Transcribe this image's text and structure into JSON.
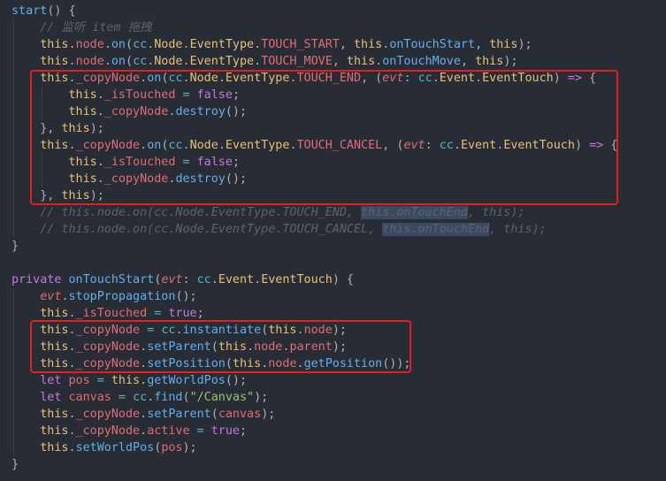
{
  "editor": {
    "colors": {
      "background": "#282c34",
      "highlight_box": "#e0201e",
      "selection": "#3a4a60"
    },
    "lines": [
      {
        "indent": 0,
        "tokens": [
          [
            "fn",
            "start"
          ],
          [
            "pu",
            "() {"
          ]
        ]
      },
      {
        "indent": 1,
        "tokens": [
          [
            "cm",
            "// 监听 item 拖拽"
          ]
        ]
      },
      {
        "indent": 1,
        "tokens": [
          [
            "th",
            "this"
          ],
          [
            "pu",
            "."
          ],
          [
            "pr",
            "node"
          ],
          [
            "pu",
            "."
          ],
          [
            "fn",
            "on"
          ],
          [
            "pu",
            "("
          ],
          [
            "cc",
            "cc"
          ],
          [
            "pu",
            "."
          ],
          [
            "ty",
            "Node"
          ],
          [
            "pu",
            "."
          ],
          [
            "ty",
            "EventType"
          ],
          [
            "pu",
            "."
          ],
          [
            "pr",
            "TOUCH_START"
          ],
          [
            "pu",
            ", "
          ],
          [
            "th",
            "this"
          ],
          [
            "pu",
            "."
          ],
          [
            "fn",
            "onTouchStart"
          ],
          [
            "pu",
            ", "
          ],
          [
            "th",
            "this"
          ],
          [
            "pu",
            ");"
          ]
        ]
      },
      {
        "indent": 1,
        "tokens": [
          [
            "th",
            "this"
          ],
          [
            "pu",
            "."
          ],
          [
            "pr",
            "node"
          ],
          [
            "pu",
            "."
          ],
          [
            "fn",
            "on"
          ],
          [
            "pu",
            "("
          ],
          [
            "cc",
            "cc"
          ],
          [
            "pu",
            "."
          ],
          [
            "ty",
            "Node"
          ],
          [
            "pu",
            "."
          ],
          [
            "ty",
            "EventType"
          ],
          [
            "pu",
            "."
          ],
          [
            "pr",
            "TOUCH_MOVE"
          ],
          [
            "pu",
            ", "
          ],
          [
            "th",
            "this"
          ],
          [
            "pu",
            "."
          ],
          [
            "fn",
            "onTouchMove"
          ],
          [
            "pu",
            ", "
          ],
          [
            "th",
            "this"
          ],
          [
            "pu",
            ");"
          ]
        ]
      },
      {
        "indent": 1,
        "tokens": [
          [
            "th",
            "this"
          ],
          [
            "pu",
            "."
          ],
          [
            "pr",
            "_copyNode"
          ],
          [
            "pu",
            "."
          ],
          [
            "fn",
            "on"
          ],
          [
            "pu",
            "("
          ],
          [
            "cc",
            "cc"
          ],
          [
            "pu",
            "."
          ],
          [
            "ty",
            "Node"
          ],
          [
            "pu",
            "."
          ],
          [
            "ty",
            "EventType"
          ],
          [
            "pu",
            "."
          ],
          [
            "pr",
            "TOUCH_END"
          ],
          [
            "pu",
            ", ("
          ],
          [
            "pa",
            "evt"
          ],
          [
            "pu",
            ": "
          ],
          [
            "cc",
            "cc"
          ],
          [
            "pu",
            "."
          ],
          [
            "ty",
            "Event"
          ],
          [
            "pu",
            "."
          ],
          [
            "ty",
            "EventTouch"
          ],
          [
            "pu",
            ") "
          ],
          [
            "ar",
            "=>"
          ],
          [
            "pu",
            " {"
          ]
        ]
      },
      {
        "indent": 2,
        "tokens": [
          [
            "th",
            "this"
          ],
          [
            "pu",
            "."
          ],
          [
            "pr",
            "_isTouched"
          ],
          [
            "op",
            " = "
          ],
          [
            "kw",
            "false"
          ],
          [
            "pu",
            ";"
          ]
        ]
      },
      {
        "indent": 2,
        "tokens": [
          [
            "th",
            "this"
          ],
          [
            "pu",
            "."
          ],
          [
            "pr",
            "_copyNode"
          ],
          [
            "pu",
            "."
          ],
          [
            "fn",
            "destroy"
          ],
          [
            "pu",
            "();"
          ]
        ]
      },
      {
        "indent": 1,
        "tokens": [
          [
            "pu",
            "}, "
          ],
          [
            "th",
            "this"
          ],
          [
            "pu",
            ");"
          ]
        ]
      },
      {
        "indent": 1,
        "tokens": [
          [
            "th",
            "this"
          ],
          [
            "pu",
            "."
          ],
          [
            "pr",
            "_copyNode"
          ],
          [
            "pu",
            "."
          ],
          [
            "fn",
            "on"
          ],
          [
            "pu",
            "("
          ],
          [
            "cc",
            "cc"
          ],
          [
            "pu",
            "."
          ],
          [
            "ty",
            "Node"
          ],
          [
            "pu",
            "."
          ],
          [
            "ty",
            "EventType"
          ],
          [
            "pu",
            "."
          ],
          [
            "pr",
            "TOUCH_CANCEL"
          ],
          [
            "pu",
            ", ("
          ],
          [
            "pa",
            "evt"
          ],
          [
            "pu",
            ": "
          ],
          [
            "cc",
            "cc"
          ],
          [
            "pu",
            "."
          ],
          [
            "ty",
            "Event"
          ],
          [
            "pu",
            "."
          ],
          [
            "ty",
            "EventTouch"
          ],
          [
            "pu",
            ") "
          ],
          [
            "ar",
            "=>"
          ],
          [
            "pu",
            " {"
          ]
        ]
      },
      {
        "indent": 2,
        "tokens": [
          [
            "th",
            "this"
          ],
          [
            "pu",
            "."
          ],
          [
            "pr",
            "_isTouched"
          ],
          [
            "op",
            " = "
          ],
          [
            "kw",
            "false"
          ],
          [
            "pu",
            ";"
          ]
        ]
      },
      {
        "indent": 2,
        "tokens": [
          [
            "th",
            "this"
          ],
          [
            "pu",
            "."
          ],
          [
            "pr",
            "_copyNode"
          ],
          [
            "pu",
            "."
          ],
          [
            "fn",
            "destroy"
          ],
          [
            "pu",
            "();"
          ]
        ]
      },
      {
        "indent": 1,
        "tokens": [
          [
            "pu",
            "}, "
          ],
          [
            "th",
            "this"
          ],
          [
            "pu",
            ");"
          ]
        ]
      },
      {
        "indent": 1,
        "tokens": [
          [
            "cm",
            "// this.node.on(cc.Node.EventType.TOUCH_END, "
          ],
          [
            "cm sel",
            "this.onTouchEnd"
          ],
          [
            "cm",
            ", this);"
          ]
        ]
      },
      {
        "indent": 1,
        "tokens": [
          [
            "cm",
            "// this.node.on(cc.Node.EventType.TOUCH_CANCEL, "
          ],
          [
            "cm sel",
            "this.onTouchEnd"
          ],
          [
            "cm",
            ", this);"
          ]
        ]
      },
      {
        "indent": 0,
        "tokens": [
          [
            "pu",
            "}"
          ]
        ]
      },
      {
        "indent": 0,
        "tokens": []
      },
      {
        "indent": 0,
        "tokens": [
          [
            "kw",
            "private"
          ],
          [
            "pu",
            " "
          ],
          [
            "fn",
            "onTouchStart"
          ],
          [
            "pu",
            "("
          ],
          [
            "pa",
            "evt"
          ],
          [
            "pu",
            ": "
          ],
          [
            "cc",
            "cc"
          ],
          [
            "pu",
            "."
          ],
          [
            "ty",
            "Event"
          ],
          [
            "pu",
            "."
          ],
          [
            "ty",
            "EventTouch"
          ],
          [
            "pu",
            ") {"
          ]
        ]
      },
      {
        "indent": 1,
        "tokens": [
          [
            "pa",
            "evt"
          ],
          [
            "pu",
            "."
          ],
          [
            "fn",
            "stopPropagation"
          ],
          [
            "pu",
            "();"
          ]
        ]
      },
      {
        "indent": 1,
        "tokens": [
          [
            "th",
            "this"
          ],
          [
            "pu",
            "."
          ],
          [
            "pr",
            "_isTouched"
          ],
          [
            "op",
            " = "
          ],
          [
            "kw",
            "true"
          ],
          [
            "pu",
            ";"
          ]
        ]
      },
      {
        "indent": 1,
        "tokens": [
          [
            "th",
            "this"
          ],
          [
            "pu",
            "."
          ],
          [
            "pr",
            "_copyNode"
          ],
          [
            "op",
            " = "
          ],
          [
            "cc",
            "cc"
          ],
          [
            "pu",
            "."
          ],
          [
            "fn",
            "instantiate"
          ],
          [
            "pu",
            "("
          ],
          [
            "th",
            "this"
          ],
          [
            "pu",
            "."
          ],
          [
            "pr",
            "node"
          ],
          [
            "pu",
            ");"
          ]
        ]
      },
      {
        "indent": 1,
        "tokens": [
          [
            "th",
            "this"
          ],
          [
            "pu",
            "."
          ],
          [
            "pr",
            "_copyNode"
          ],
          [
            "pu",
            "."
          ],
          [
            "fn",
            "setParent"
          ],
          [
            "pu",
            "("
          ],
          [
            "th",
            "this"
          ],
          [
            "pu",
            "."
          ],
          [
            "pr",
            "node"
          ],
          [
            "pu",
            "."
          ],
          [
            "pr",
            "parent"
          ],
          [
            "pu",
            ");"
          ]
        ]
      },
      {
        "indent": 1,
        "tokens": [
          [
            "th",
            "this"
          ],
          [
            "pu",
            "."
          ],
          [
            "pr",
            "_copyNode"
          ],
          [
            "pu",
            "."
          ],
          [
            "fn",
            "setPosition"
          ],
          [
            "pu",
            "("
          ],
          [
            "th",
            "this"
          ],
          [
            "pu",
            "."
          ],
          [
            "pr",
            "node"
          ],
          [
            "pu",
            "."
          ],
          [
            "fn",
            "getPosition"
          ],
          [
            "pu",
            "());"
          ]
        ]
      },
      {
        "indent": 1,
        "tokens": [
          [
            "kw",
            "let"
          ],
          [
            "pu",
            " "
          ],
          [
            "pr",
            "pos"
          ],
          [
            "op",
            " = "
          ],
          [
            "th",
            "this"
          ],
          [
            "pu",
            "."
          ],
          [
            "fn",
            "getWorldPos"
          ],
          [
            "pu",
            "();"
          ]
        ]
      },
      {
        "indent": 1,
        "tokens": [
          [
            "kw",
            "let"
          ],
          [
            "pu",
            " "
          ],
          [
            "pr",
            "canvas"
          ],
          [
            "op",
            " = "
          ],
          [
            "cc",
            "cc"
          ],
          [
            "pu",
            "."
          ],
          [
            "fn",
            "find"
          ],
          [
            "pu",
            "("
          ],
          [
            "st",
            "\"/Canvas\""
          ],
          [
            "pu",
            ");"
          ]
        ]
      },
      {
        "indent": 1,
        "tokens": [
          [
            "th",
            "this"
          ],
          [
            "pu",
            "."
          ],
          [
            "pr",
            "_copyNode"
          ],
          [
            "pu",
            "."
          ],
          [
            "fn",
            "setParent"
          ],
          [
            "pu",
            "("
          ],
          [
            "pr",
            "canvas"
          ],
          [
            "pu",
            ");"
          ]
        ]
      },
      {
        "indent": 1,
        "tokens": [
          [
            "th",
            "this"
          ],
          [
            "pu",
            "."
          ],
          [
            "pr",
            "_copyNode"
          ],
          [
            "pu",
            "."
          ],
          [
            "pr",
            "active"
          ],
          [
            "op",
            " = "
          ],
          [
            "kw",
            "true"
          ],
          [
            "pu",
            ";"
          ]
        ]
      },
      {
        "indent": 1,
        "tokens": [
          [
            "th",
            "this"
          ],
          [
            "pu",
            "."
          ],
          [
            "fn",
            "setWorldPos"
          ],
          [
            "pu",
            "("
          ],
          [
            "pr",
            "pos"
          ],
          [
            "pu",
            ");"
          ]
        ]
      },
      {
        "indent": 0,
        "tokens": [
          [
            "pu",
            "}"
          ]
        ]
      }
    ]
  }
}
